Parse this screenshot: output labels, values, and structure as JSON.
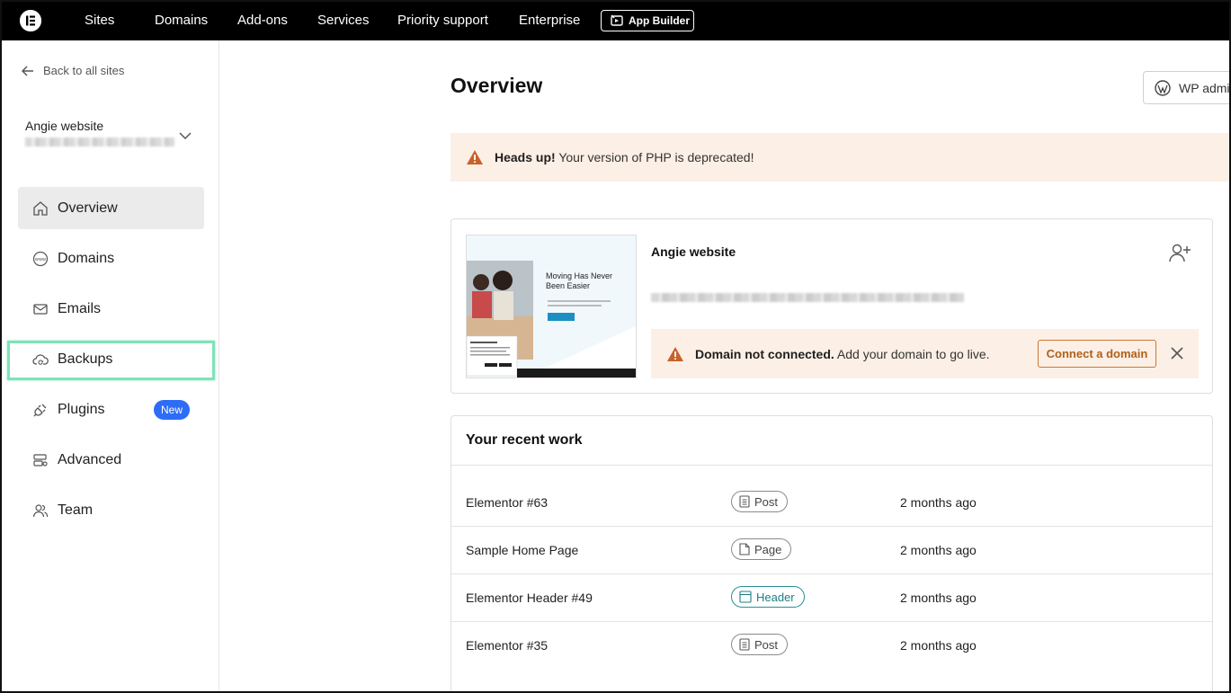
{
  "topnav": {
    "items": [
      "Sites",
      "Domains",
      "Add-ons",
      "Services",
      "Priority support",
      "Enterprise"
    ],
    "app_builder": "App Builder"
  },
  "sidebar": {
    "back_label": "Back to all sites",
    "site_name": "Angie website",
    "items": [
      {
        "label": "Overview",
        "icon": "home-icon"
      },
      {
        "label": "Domains",
        "icon": "www-globe-icon"
      },
      {
        "label": "Emails",
        "icon": "envelope-icon"
      },
      {
        "label": "Backups",
        "icon": "cloud-sync-icon"
      },
      {
        "label": "Plugins",
        "icon": "plug-icon",
        "badge": "New"
      },
      {
        "label": "Advanced",
        "icon": "server-settings-icon"
      },
      {
        "label": "Team",
        "icon": "users-icon"
      }
    ]
  },
  "main": {
    "title": "Overview",
    "wp_admin_label": "WP admi",
    "php_alert": {
      "bold": "Heads up!",
      "text": "Your version of PHP is deprecated!"
    },
    "site_card": {
      "site_name": "Angie website",
      "thumb_headline": "Moving Has Never Been Easier",
      "domain_alert": {
        "bold": "Domain not connected.",
        "text": "Add your domain to go live."
      },
      "connect_label": "Connect a domain"
    },
    "recent": {
      "title": "Your recent work",
      "rows": [
        {
          "name": "Elementor #63",
          "type": "Post",
          "time": "2 months ago"
        },
        {
          "name": "Sample Home Page",
          "type": "Page",
          "time": "2 months ago"
        },
        {
          "name": "Elementor Header #49",
          "type": "Header",
          "time": "2 months ago"
        },
        {
          "name": "Elementor #35",
          "type": "Post",
          "time": "2 months ago"
        }
      ]
    }
  },
  "colors": {
    "nav_bg": "#000000",
    "alert_bg": "#fcefe5",
    "warning": "#c6622b",
    "badge_blue": "#2d6df6",
    "highlight": "#7fe3b8",
    "header_tag": "#2a8f95"
  }
}
